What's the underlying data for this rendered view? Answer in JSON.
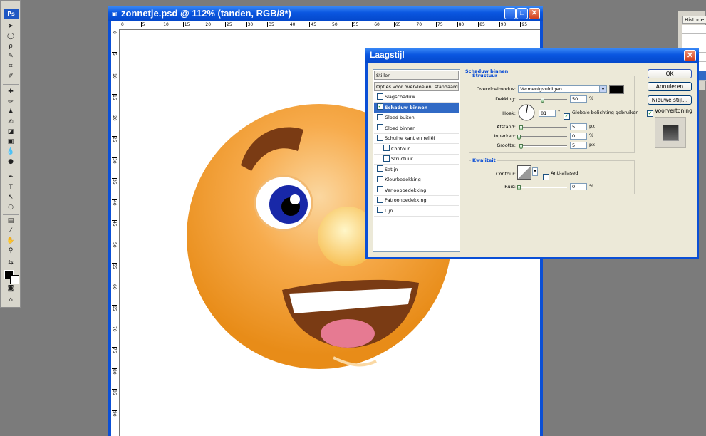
{
  "toolbox": {
    "logo": "Ps"
  },
  "document": {
    "title": "zonnetje.psd @ 112% (tanden, RGB/8*)",
    "ruler_top_ticks": [
      "0",
      "5",
      "10",
      "15",
      "20",
      "25",
      "30",
      "35",
      "40",
      "45",
      "50",
      "55",
      "60",
      "65",
      "70",
      "75",
      "80",
      "85",
      "90",
      "95"
    ],
    "ruler_left_ticks": [
      "0",
      "5",
      "10",
      "15",
      "20",
      "25",
      "30",
      "35",
      "40",
      "45",
      "50",
      "55",
      "60",
      "65",
      "70",
      "75",
      "80",
      "85",
      "90"
    ],
    "min_label": "_",
    "max_label": "□",
    "close_label": "✕"
  },
  "history": {
    "tab": "Historie ×"
  },
  "dialog": {
    "title": "Laagstijl",
    "close_label": "✕",
    "styles_header": "Stijlen",
    "blend_options": "Opties voor overvloeien: standaard",
    "items": [
      {
        "label": "Slagschaduw",
        "checked": false,
        "selected": false,
        "indent": false
      },
      {
        "label": "Schaduw binnen",
        "checked": true,
        "selected": true,
        "indent": false
      },
      {
        "label": "Gloed buiten",
        "checked": false,
        "selected": false,
        "indent": false
      },
      {
        "label": "Gloed binnen",
        "checked": false,
        "selected": false,
        "indent": false
      },
      {
        "label": "Schuine kant en reliëf",
        "checked": false,
        "selected": false,
        "indent": false
      },
      {
        "label": "Contour",
        "checked": false,
        "selected": false,
        "indent": true
      },
      {
        "label": "Structuur",
        "checked": false,
        "selected": false,
        "indent": true
      },
      {
        "label": "Satijn",
        "checked": false,
        "selected": false,
        "indent": false
      },
      {
        "label": "Kleurbedekking",
        "checked": false,
        "selected": false,
        "indent": false
      },
      {
        "label": "Verloopbedekking",
        "checked": false,
        "selected": false,
        "indent": false
      },
      {
        "label": "Patroonbedekking",
        "checked": false,
        "selected": false,
        "indent": false
      },
      {
        "label": "Lijn",
        "checked": false,
        "selected": false,
        "indent": false
      }
    ],
    "section_title": "Schaduw binnen",
    "structure": {
      "title": "Structuur",
      "blend_mode_label": "Overvloeimodus:",
      "blend_mode_value": "Vermenigvuldigen",
      "shadow_color": "#000000",
      "opacity_label": "Dekking:",
      "opacity_value": "50",
      "opacity_unit": "%",
      "angle_label": "Hoek:",
      "angle_value": "81",
      "angle_unit": "°",
      "global_light_label": "Globale belichting gebruiken",
      "global_light_checked": true,
      "distance_label": "Afstand:",
      "distance_value": "5",
      "distance_unit": "px",
      "choke_label": "Inperken:",
      "choke_value": "0",
      "choke_unit": "%",
      "size_label": "Grootte:",
      "size_value": "5",
      "size_unit": "px"
    },
    "quality": {
      "title": "Kwaliteit",
      "contour_label": "Contour:",
      "anti_aliased_label": "Anti-aliased",
      "noise_label": "Ruis:",
      "noise_value": "0",
      "noise_unit": "%"
    },
    "buttons": {
      "ok": "OK",
      "cancel": "Annuleren",
      "new_style": "Nieuwe stijl...",
      "preview_label": "Voorvertoning",
      "preview_checked": true
    }
  }
}
